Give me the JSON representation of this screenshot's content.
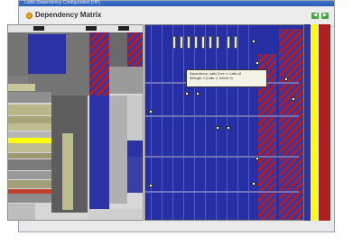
{
  "window": {
    "title": "Lattix Dependency Configuration [HP]",
    "header_title": "Dependency Matrix"
  },
  "tooltip": {
    "line1": "Dependency: Lattix.Core <> Lattix.UI",
    "line2": "Strength: 2 (Calls: 2, Inherit: 0)"
  },
  "nav": {
    "back": "◀",
    "forward": "▶"
  },
  "colors": {
    "matrix_blue": "#272fa5",
    "highlight_yellow": "#ffff00",
    "cycle_red": "#b01f1f"
  }
}
